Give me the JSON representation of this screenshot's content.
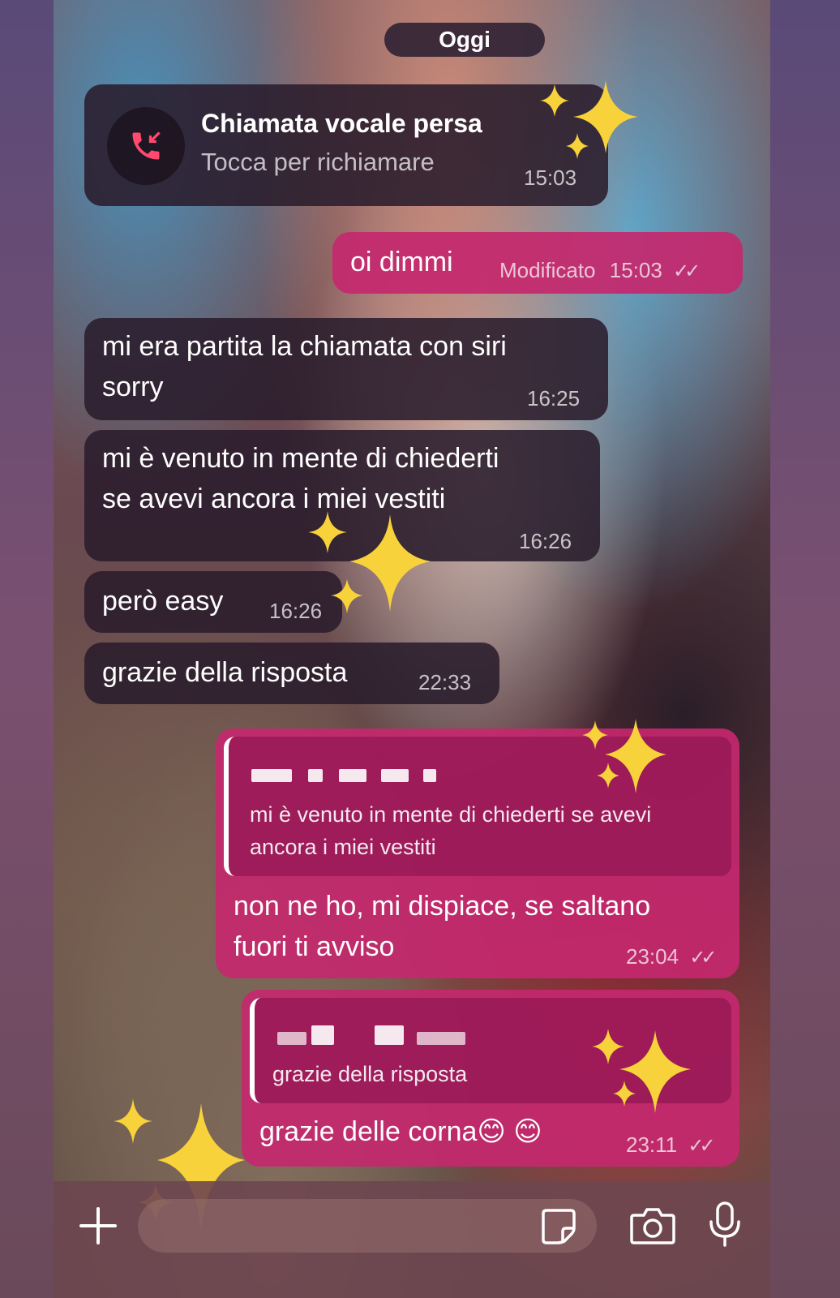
{
  "date_separator": "Oggi",
  "missed_call": {
    "title": "Chiamata vocale persa",
    "subtitle": "Tocca per richiamare",
    "time": "15:03"
  },
  "messages": [
    {
      "dir": "out",
      "text": "oi dimmi",
      "edited": "Modificato",
      "time": "15:03",
      "status": "read"
    },
    {
      "dir": "in",
      "lines": [
        "mi era partita la chiamata con siri",
        "sorry"
      ],
      "time": "16:25"
    },
    {
      "dir": "in",
      "lines": [
        "mi è venuto in mente di chiederti",
        "se avevi ancora i miei vestiti"
      ],
      "time": "16:26"
    },
    {
      "dir": "in",
      "text": "però easy",
      "time": "16:26"
    },
    {
      "dir": "in",
      "text": "grazie della risposta",
      "time": "22:33"
    },
    {
      "dir": "out",
      "quote": [
        "mi è venuto in mente di chiederti se avevi",
        "ancora i miei vestiti"
      ],
      "lines": [
        "non ne ho, mi dispiace, se saltano",
        "fuori ti avviso"
      ],
      "time": "23:04",
      "status": "read"
    },
    {
      "dir": "out",
      "quote": [
        "grazie della risposta"
      ],
      "text": "grazie delle corna😊 😊",
      "time": "23:11",
      "status": "read"
    }
  ],
  "input_bar": {
    "icons": [
      "plus-icon",
      "sticker-icon",
      "camera-icon",
      "microphone-icon"
    ]
  },
  "colors": {
    "incoming_bubble": "#2a1c2c",
    "outgoing_bubble": "#c4286e",
    "sparkle": "#f8d23a",
    "missed_call_icon": "#ff4a6e"
  }
}
